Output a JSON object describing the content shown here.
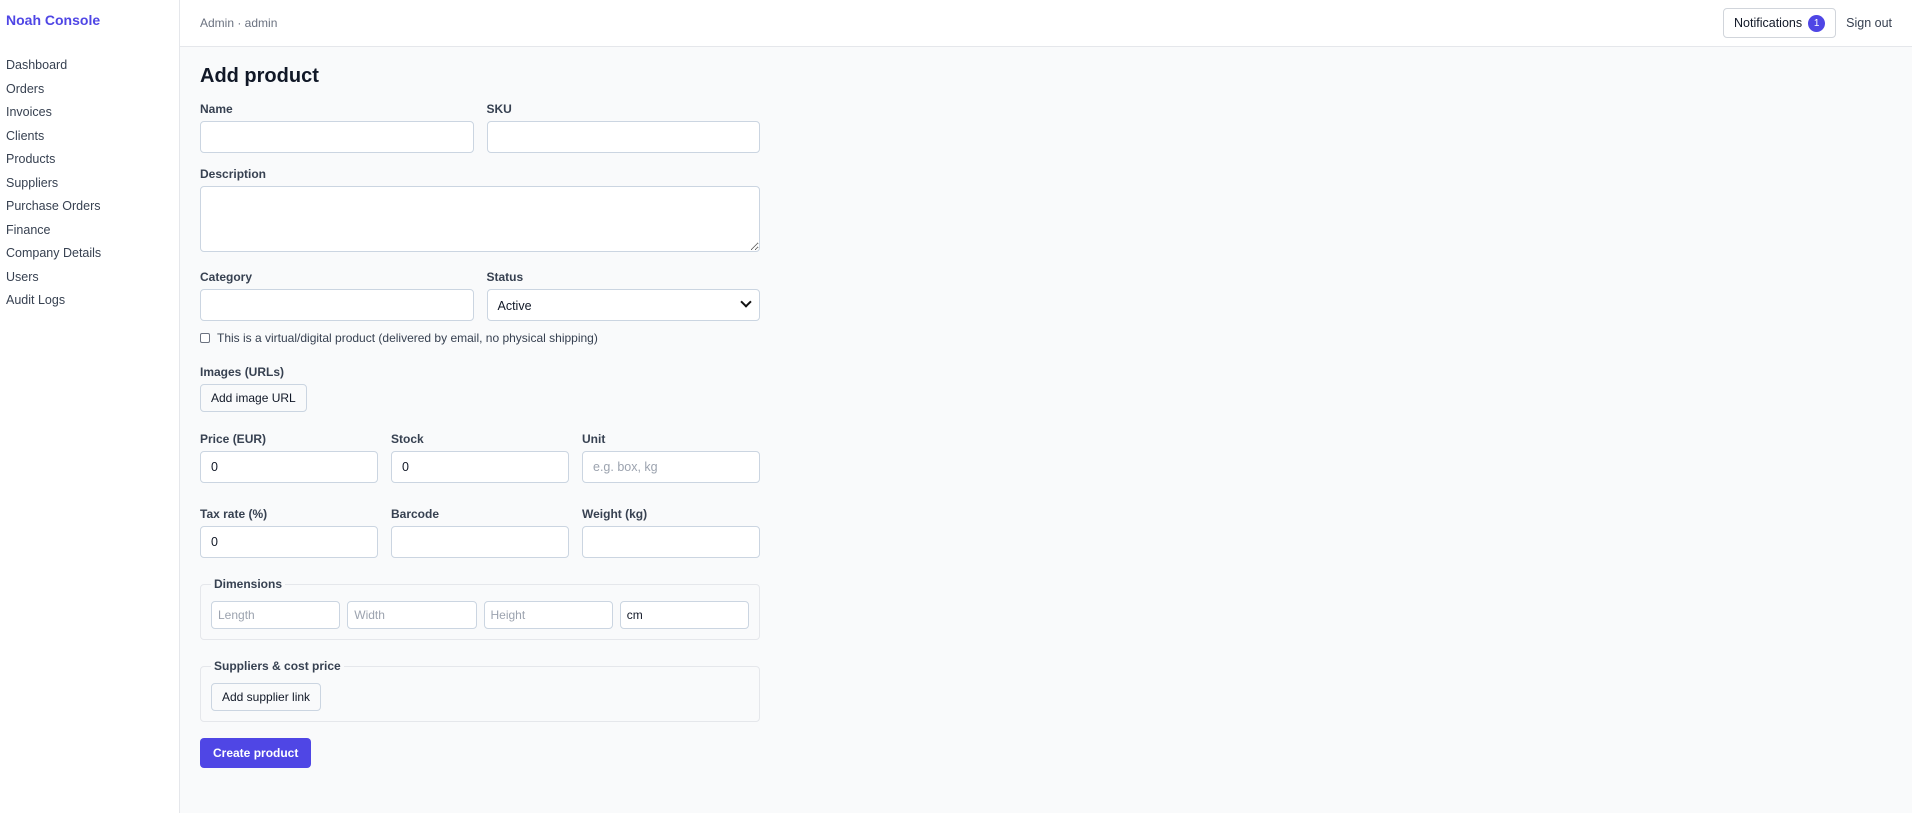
{
  "brand": "Noah Console",
  "nav": [
    "Dashboard",
    "Orders",
    "Invoices",
    "Clients",
    "Products",
    "Suppliers",
    "Purchase Orders",
    "Finance",
    "Company Details",
    "Users",
    "Audit Logs"
  ],
  "topbar": {
    "breadcrumb": "Admin · admin",
    "notifications_label": "Notifications",
    "notifications_count": "1",
    "signout_label": "Sign out"
  },
  "form": {
    "title": "Add product",
    "name_label": "Name",
    "sku_label": "SKU",
    "description_label": "Description",
    "category_label": "Category",
    "status_label": "Status",
    "status_value": "Active",
    "virtual_label": "This is a virtual/digital product (delivered by email, no physical shipping)",
    "images_label": "Images (URLs)",
    "add_image_label": "Add image URL",
    "price_label": "Price (EUR)",
    "price_value": "0",
    "stock_label": "Stock",
    "stock_value": "0",
    "unit_label": "Unit",
    "unit_placeholder": "e.g. box, kg",
    "tax_label": "Tax rate (%)",
    "tax_value": "0",
    "barcode_label": "Barcode",
    "weight_label": "Weight (kg)",
    "dimensions_legend": "Dimensions",
    "length_placeholder": "Length",
    "width_placeholder": "Width",
    "height_placeholder": "Height",
    "dim_unit_value": "cm",
    "suppliers_legend": "Suppliers & cost price",
    "add_supplier_label": "Add supplier link",
    "create_label": "Create product"
  },
  "colors": {
    "accent": "#4f46e5"
  }
}
